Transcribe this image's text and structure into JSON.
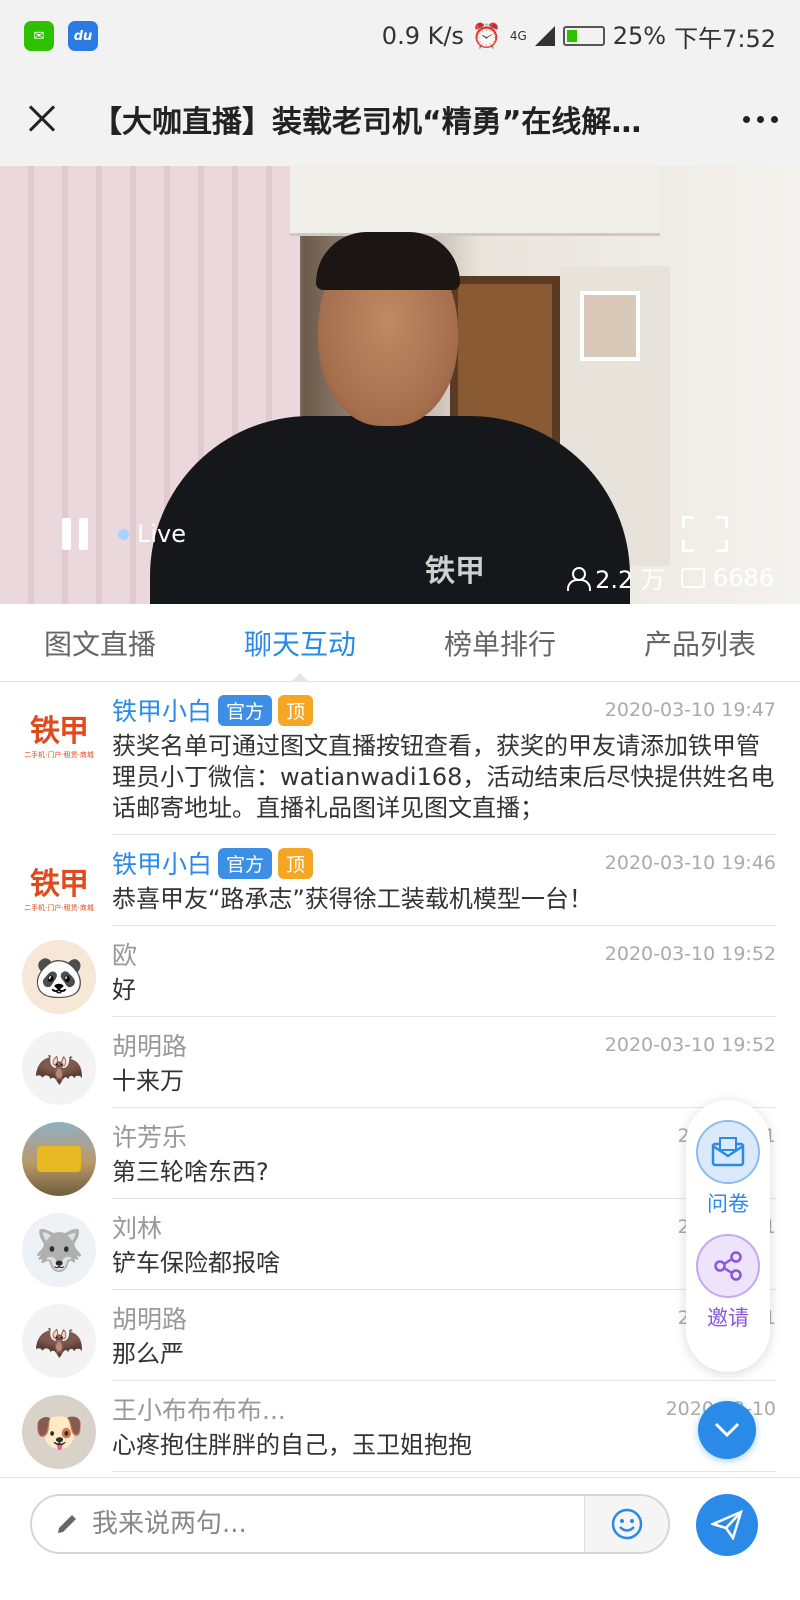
{
  "status_bar": {
    "network_speed": "0.9 K/s",
    "network_type": "4G",
    "battery": "25%",
    "time": "下午7:52",
    "app_icons": [
      "wechat-icon",
      "du-icon"
    ],
    "du_label": "du"
  },
  "header": {
    "title": "【大咖直播】装载老司机“精勇”在线解…"
  },
  "video": {
    "live_label": "Live",
    "viewers": "2.2 万",
    "comments": "6686",
    "shirt_logo": "铁甲"
  },
  "tabs": [
    {
      "label": "图文直播",
      "active": false
    },
    {
      "label": "聊天互动",
      "active": true
    },
    {
      "label": "榜单排行",
      "active": false
    },
    {
      "label": "产品列表",
      "active": false
    }
  ],
  "messages": [
    {
      "name": "铁甲小白",
      "official": true,
      "tag_official": "官方",
      "tag_top": "顶",
      "time": "2020-03-10 19:47",
      "text": "获奖名单可通过图文直播按钮查看，获奖的甲友请添加铁甲管理员小丁微信：watianwadi168，活动结束后尽快提供姓名电话邮寄地址。直播礼品图详见图文直播；",
      "avatar": "logo"
    },
    {
      "name": "铁甲小白",
      "official": true,
      "tag_official": "官方",
      "tag_top": "顶",
      "time": "2020-03-10 19:46",
      "text": "恭喜甲友“路承志”获得徐工装载机模型一台！",
      "avatar": "logo"
    },
    {
      "name": "欧",
      "official": false,
      "time": "2020-03-10 19:52",
      "text": "好",
      "avatar": "panda"
    },
    {
      "name": "胡明路",
      "official": false,
      "time": "2020-03-10 19:52",
      "text": "十来万",
      "avatar": "bat"
    },
    {
      "name": "许芳乐",
      "official": false,
      "time": "2020-03-1",
      "text": "第三轮啥东西?",
      "avatar": "loader"
    },
    {
      "name": "刘林",
      "official": false,
      "time": "2020-03-1",
      "text": "铲车保险都报啥",
      "avatar": "dog"
    },
    {
      "name": "胡明路",
      "official": false,
      "time": "2020-03-1",
      "text": "那么严",
      "avatar": "bat"
    },
    {
      "name": "王小布布布布...",
      "official": false,
      "time": "2020-03-10",
      "text": "心疼抱住胖胖的自己，玉卫姐抱抱",
      "avatar": "pup"
    }
  ],
  "logo_avatar": {
    "text": "铁甲",
    "sub": "二手机·门户·租赁·商城"
  },
  "floating": {
    "survey_label": "问卷",
    "invite_label": "邀请"
  },
  "input": {
    "placeholder": "我来说两句..."
  },
  "colors": {
    "accent": "#2a8ae8",
    "official_tag": "#3c8ee6",
    "top_tag": "#f5a623",
    "invite": "#8a58d8"
  }
}
